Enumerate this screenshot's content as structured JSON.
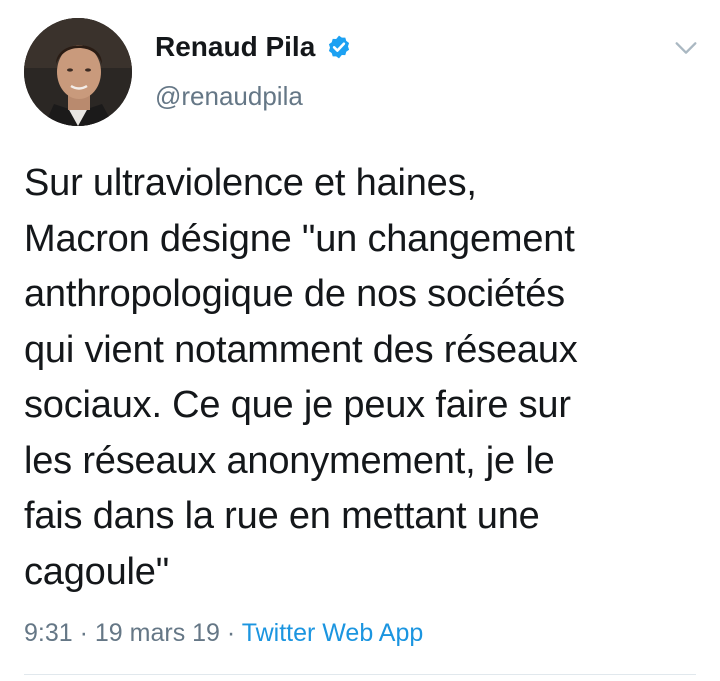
{
  "user": {
    "display_name": "Renaud Pila",
    "handle": "@renaudpila",
    "verified": true
  },
  "icons": {
    "avatar": "profile-photo",
    "verified": "verified-badge-icon",
    "menu": "chevron-down-icon"
  },
  "tweet": {
    "text": "Sur ultraviolence et haines,\nMacron désigne \"un changement\nanthropologique de nos sociétés\nqui vient notamment des réseaux\nsociaux. Ce que je peux faire sur\nles réseaux anonymement, je le\nfais dans la rue en mettant une\ncagoule\"",
    "time": "9:31",
    "separator": " · ",
    "date": "19 mars 19",
    "source": "Twitter Web App"
  },
  "colors": {
    "text": "#14171a",
    "secondary": "#657786",
    "link": "#1b95e0",
    "verified": "#1da1f2",
    "divider": "#e1e8ed"
  }
}
